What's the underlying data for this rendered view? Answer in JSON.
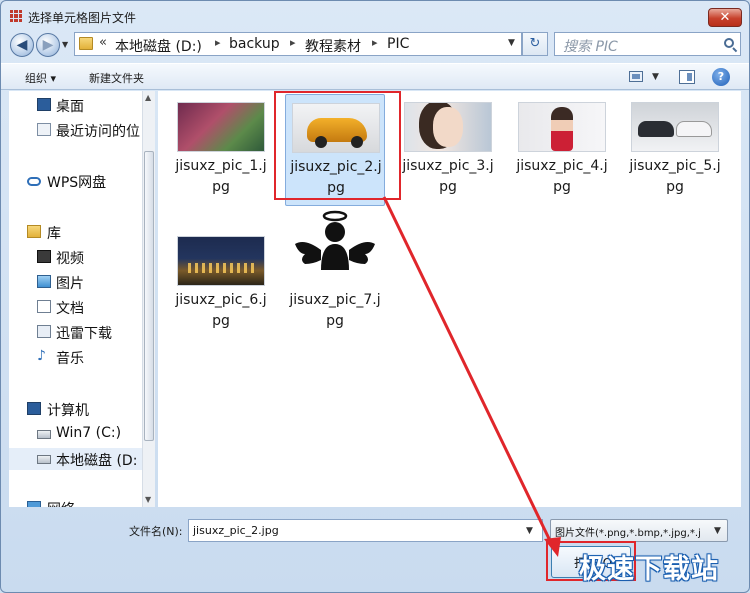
{
  "window": {
    "title": "选择单元格图片文件",
    "close_glyph": "✕"
  },
  "nav": {
    "back_glyph": "◀",
    "forward_glyph": "▶",
    "dropdown_glyph": "▼"
  },
  "address": {
    "chevron": "«",
    "segments": [
      "本地磁盘 (D:)",
      "backup",
      "教程素材",
      "PIC"
    ],
    "separator": "▸",
    "dropdown_glyph": "▼"
  },
  "refresh_glyph": "↻",
  "search": {
    "placeholder": "搜索 PIC"
  },
  "toolbar": {
    "organize": "组织 ▾",
    "new_folder": "新建文件夹",
    "view_dd": "▼",
    "help": "?"
  },
  "sidebar": {
    "items": [
      {
        "label": "桌面",
        "icon": "desktop-icon"
      },
      {
        "label": "最近访问的位",
        "icon": "recent-icon"
      },
      {
        "label": "WPS网盘",
        "icon": "cloud-icon"
      },
      {
        "label": "库",
        "icon": "library-icon"
      },
      {
        "label": "视频",
        "icon": "video-icon"
      },
      {
        "label": "图片",
        "icon": "picture-icon"
      },
      {
        "label": "文档",
        "icon": "document-icon"
      },
      {
        "label": "迅雷下载",
        "icon": "thunder-icon"
      },
      {
        "label": "音乐",
        "icon": "music-icon"
      },
      {
        "label": "计算机",
        "icon": "computer-icon"
      },
      {
        "label": "Win7 (C:)",
        "icon": "drive-icon"
      },
      {
        "label": "本地磁盘 (D:",
        "icon": "drive-icon"
      },
      {
        "label": "网络",
        "icon": "network-icon"
      }
    ],
    "selected_index": 11
  },
  "files": [
    {
      "name": "jisuxz_pic_1.jpg",
      "thumb": "pink-flowers-hillside"
    },
    {
      "name": "jisuxz_pic_2.jpg",
      "thumb": "yellow-suv"
    },
    {
      "name": "jisuxz_pic_3.jpg",
      "thumb": "woman-portrait"
    },
    {
      "name": "jisuxz_pic_4.jpg",
      "thumb": "woman-red-dress"
    },
    {
      "name": "jisuxz_pic_5.jpg",
      "thumb": "two-sports-cars"
    },
    {
      "name": "jisuxz_pic_6.jpg",
      "thumb": "castle-night"
    },
    {
      "name": "jisuxz_pic_7.jpg",
      "thumb": "angel-silhouette"
    }
  ],
  "selected_file": 1,
  "bottom": {
    "filename_label": "文件名(N):",
    "filename_value": "jisuxz_pic_2.jpg",
    "filter_value": "图片文件(*.png,*.bmp,*.jpg,*.j",
    "open_label": "打开(O)"
  },
  "watermark": "极速下载站",
  "colors": {
    "highlight": "#e0262b",
    "selection": "#cce4fb"
  }
}
